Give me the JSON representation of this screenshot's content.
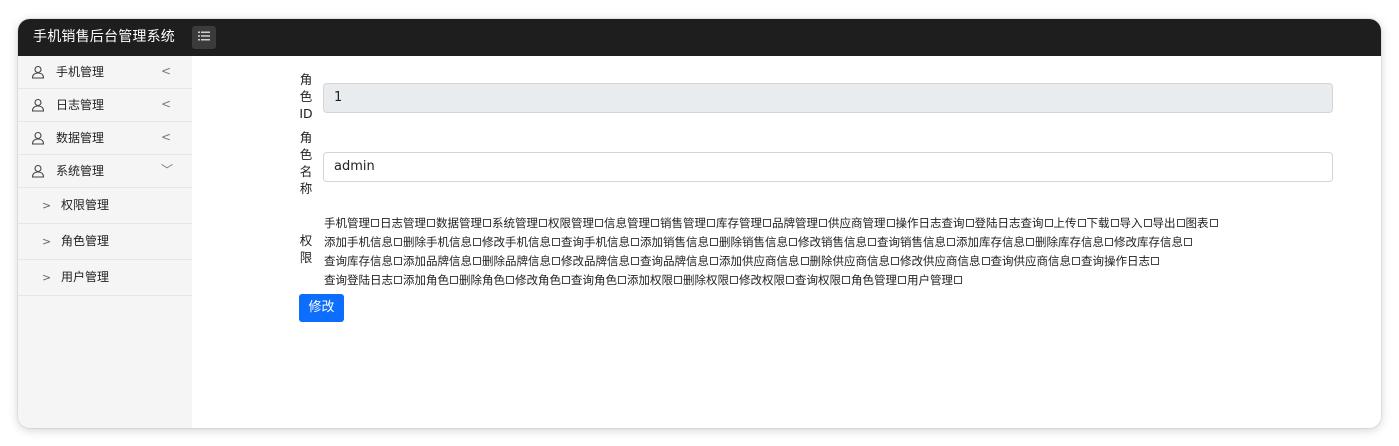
{
  "app": {
    "title": "手机销售后台管理系统",
    "menu_toggle_icon": "list-icon"
  },
  "sidebar": {
    "items": [
      {
        "label": "手机管理",
        "icon": "user-icon",
        "arrow": "<"
      },
      {
        "label": "日志管理",
        "icon": "user-icon",
        "arrow": "<"
      },
      {
        "label": "数据管理",
        "icon": "user-icon",
        "arrow": "<"
      },
      {
        "label": "系统管理",
        "icon": "user-icon",
        "arrow": "﹀"
      }
    ],
    "subitems": [
      {
        "label": "权限管理",
        "chevron": ">"
      },
      {
        "label": "角色管理",
        "chevron": ">"
      },
      {
        "label": "用户管理",
        "chevron": ">"
      }
    ]
  },
  "form": {
    "role_id_label": "角色ID",
    "role_id_value": "1",
    "role_name_label": "角色名称",
    "role_name_value": "admin",
    "perm_label": "权限",
    "permission_lines": [
      [
        "手机管理",
        "日志管理",
        "数据管理",
        "系统管理",
        "权限管理",
        "信息管理",
        "销售管理",
        "库存管理",
        "品牌管理",
        "供应商管理",
        "操作日志查询",
        "登陆日志查询",
        "上传",
        "下载",
        "导入",
        "导出",
        "图表"
      ],
      [
        "添加手机信息",
        "删除手机信息",
        "修改手机信息",
        "查询手机信息",
        "添加销售信息",
        "删除销售信息",
        "修改销售信息",
        "查询销售信息",
        "添加库存信息",
        "删除库存信息",
        "修改库存信息"
      ],
      [
        "查询库存信息",
        "添加品牌信息",
        "删除品牌信息",
        "修改品牌信息",
        "查询品牌信息",
        "添加供应商信息",
        "删除供应商信息",
        "修改供应商信息",
        "查询供应商信息",
        "查询操作日志"
      ],
      [
        "查询登陆日志",
        "添加角色",
        "删除角色",
        "修改角色",
        "查询角色",
        "添加权限",
        "删除权限",
        "修改权限",
        "查询权限",
        "角色管理",
        "用户管理"
      ]
    ],
    "submit_label": "修改"
  },
  "colors": {
    "topbar": "#1e1e1e",
    "sidebar": "#f5f5f5",
    "primary": "#0d6efd",
    "readonly_bg": "#e9ecef"
  }
}
